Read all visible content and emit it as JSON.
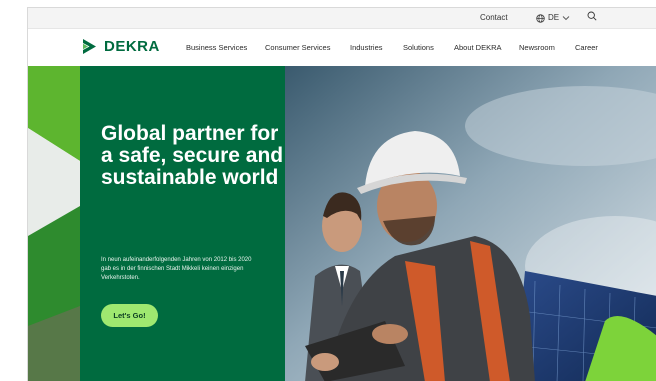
{
  "utility_bar": {
    "contact": "Contact",
    "language": "DE",
    "icons": [
      "globe-icon",
      "chevron-down-icon",
      "search-icon"
    ]
  },
  "brand": {
    "name": "DEKRA",
    "color": "#006B3F"
  },
  "nav": {
    "items": [
      "Business Services",
      "Consumer Services",
      "Industries",
      "Solutions",
      "About DEKRA",
      "Newsroom",
      "Career"
    ]
  },
  "hero": {
    "title": "Global partner for a safe, secure and sustainable world",
    "text": "In neun aufeinanderfolgenden Jahren von 2012 bis 2020 gab es in der finnischen Stadt Mikkeli keinen einzigen Verkehrstoten.",
    "button_label": "Let's Go!",
    "panel_color": "#006B3F",
    "button_color": "#9FE870"
  }
}
